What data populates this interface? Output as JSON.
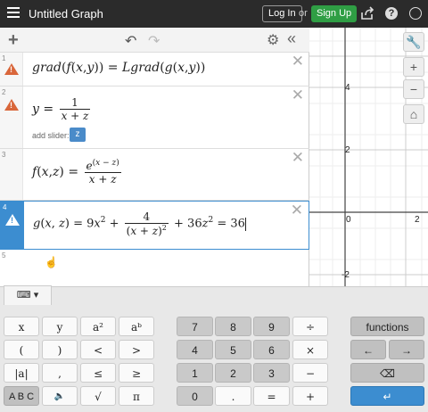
{
  "header": {
    "title": "Untitled Graph",
    "login_label": "Log In",
    "or_text": "or",
    "signup_label": "Sign Up"
  },
  "expressions": [
    {
      "index": "1",
      "warning": true
    },
    {
      "index": "2",
      "warning": true,
      "add_slider_label": "add slider:",
      "slider_var": "z"
    },
    {
      "index": "3",
      "warning": false
    },
    {
      "index": "4",
      "warning": true,
      "active": true
    },
    {
      "index": "5",
      "warning": false
    }
  ],
  "graph": {
    "y_ticks": [
      "4",
      "2",
      "-2"
    ],
    "x_ticks": [
      "0",
      "2"
    ]
  },
  "keypad": {
    "row1": [
      "x",
      "y",
      "a²",
      "aᵇ",
      "7",
      "8",
      "9",
      "÷",
      "functions"
    ],
    "row2": [
      "(",
      ")",
      "<",
      ">",
      "4",
      "5",
      "6",
      "×",
      "←",
      "→"
    ],
    "row3": [
      "|a|",
      ",",
      "≤",
      "≥",
      "1",
      "2",
      "3",
      "−",
      "⌫"
    ],
    "row4": [
      "A B C",
      "🔈",
      "√",
      "π",
      "0",
      ".",
      "=",
      "+",
      "↵"
    ]
  },
  "colors": {
    "topbar": "#2b2b2b",
    "signup": "#2f9e44",
    "warning": "#d9663a",
    "active": "#3c8dd0"
  }
}
